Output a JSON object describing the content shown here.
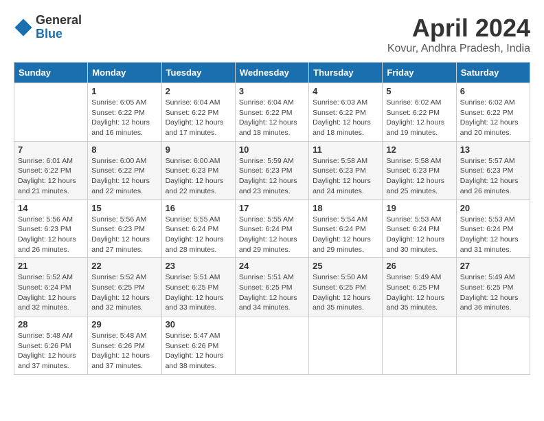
{
  "header": {
    "logo_general": "General",
    "logo_blue": "Blue",
    "month_title": "April 2024",
    "location": "Kovur, Andhra Pradesh, India"
  },
  "days_of_week": [
    "Sunday",
    "Monday",
    "Tuesday",
    "Wednesday",
    "Thursday",
    "Friday",
    "Saturday"
  ],
  "weeks": [
    [
      {
        "day": "",
        "info": ""
      },
      {
        "day": "1",
        "info": "Sunrise: 6:05 AM\nSunset: 6:22 PM\nDaylight: 12 hours\nand 16 minutes."
      },
      {
        "day": "2",
        "info": "Sunrise: 6:04 AM\nSunset: 6:22 PM\nDaylight: 12 hours\nand 17 minutes."
      },
      {
        "day": "3",
        "info": "Sunrise: 6:04 AM\nSunset: 6:22 PM\nDaylight: 12 hours\nand 18 minutes."
      },
      {
        "day": "4",
        "info": "Sunrise: 6:03 AM\nSunset: 6:22 PM\nDaylight: 12 hours\nand 18 minutes."
      },
      {
        "day": "5",
        "info": "Sunrise: 6:02 AM\nSunset: 6:22 PM\nDaylight: 12 hours\nand 19 minutes."
      },
      {
        "day": "6",
        "info": "Sunrise: 6:02 AM\nSunset: 6:22 PM\nDaylight: 12 hours\nand 20 minutes."
      }
    ],
    [
      {
        "day": "7",
        "info": "Sunrise: 6:01 AM\nSunset: 6:22 PM\nDaylight: 12 hours\nand 21 minutes."
      },
      {
        "day": "8",
        "info": "Sunrise: 6:00 AM\nSunset: 6:22 PM\nDaylight: 12 hours\nand 22 minutes."
      },
      {
        "day": "9",
        "info": "Sunrise: 6:00 AM\nSunset: 6:23 PM\nDaylight: 12 hours\nand 22 minutes."
      },
      {
        "day": "10",
        "info": "Sunrise: 5:59 AM\nSunset: 6:23 PM\nDaylight: 12 hours\nand 23 minutes."
      },
      {
        "day": "11",
        "info": "Sunrise: 5:58 AM\nSunset: 6:23 PM\nDaylight: 12 hours\nand 24 minutes."
      },
      {
        "day": "12",
        "info": "Sunrise: 5:58 AM\nSunset: 6:23 PM\nDaylight: 12 hours\nand 25 minutes."
      },
      {
        "day": "13",
        "info": "Sunrise: 5:57 AM\nSunset: 6:23 PM\nDaylight: 12 hours\nand 26 minutes."
      }
    ],
    [
      {
        "day": "14",
        "info": "Sunrise: 5:56 AM\nSunset: 6:23 PM\nDaylight: 12 hours\nand 26 minutes."
      },
      {
        "day": "15",
        "info": "Sunrise: 5:56 AM\nSunset: 6:23 PM\nDaylight: 12 hours\nand 27 minutes."
      },
      {
        "day": "16",
        "info": "Sunrise: 5:55 AM\nSunset: 6:24 PM\nDaylight: 12 hours\nand 28 minutes."
      },
      {
        "day": "17",
        "info": "Sunrise: 5:55 AM\nSunset: 6:24 PM\nDaylight: 12 hours\nand 29 minutes."
      },
      {
        "day": "18",
        "info": "Sunrise: 5:54 AM\nSunset: 6:24 PM\nDaylight: 12 hours\nand 29 minutes."
      },
      {
        "day": "19",
        "info": "Sunrise: 5:53 AM\nSunset: 6:24 PM\nDaylight: 12 hours\nand 30 minutes."
      },
      {
        "day": "20",
        "info": "Sunrise: 5:53 AM\nSunset: 6:24 PM\nDaylight: 12 hours\nand 31 minutes."
      }
    ],
    [
      {
        "day": "21",
        "info": "Sunrise: 5:52 AM\nSunset: 6:24 PM\nDaylight: 12 hours\nand 32 minutes."
      },
      {
        "day": "22",
        "info": "Sunrise: 5:52 AM\nSunset: 6:25 PM\nDaylight: 12 hours\nand 32 minutes."
      },
      {
        "day": "23",
        "info": "Sunrise: 5:51 AM\nSunset: 6:25 PM\nDaylight: 12 hours\nand 33 minutes."
      },
      {
        "day": "24",
        "info": "Sunrise: 5:51 AM\nSunset: 6:25 PM\nDaylight: 12 hours\nand 34 minutes."
      },
      {
        "day": "25",
        "info": "Sunrise: 5:50 AM\nSunset: 6:25 PM\nDaylight: 12 hours\nand 35 minutes."
      },
      {
        "day": "26",
        "info": "Sunrise: 5:49 AM\nSunset: 6:25 PM\nDaylight: 12 hours\nand 35 minutes."
      },
      {
        "day": "27",
        "info": "Sunrise: 5:49 AM\nSunset: 6:25 PM\nDaylight: 12 hours\nand 36 minutes."
      }
    ],
    [
      {
        "day": "28",
        "info": "Sunrise: 5:48 AM\nSunset: 6:26 PM\nDaylight: 12 hours\nand 37 minutes."
      },
      {
        "day": "29",
        "info": "Sunrise: 5:48 AM\nSunset: 6:26 PM\nDaylight: 12 hours\nand 37 minutes."
      },
      {
        "day": "30",
        "info": "Sunrise: 5:47 AM\nSunset: 6:26 PM\nDaylight: 12 hours\nand 38 minutes."
      },
      {
        "day": "",
        "info": ""
      },
      {
        "day": "",
        "info": ""
      },
      {
        "day": "",
        "info": ""
      },
      {
        "day": "",
        "info": ""
      }
    ]
  ]
}
